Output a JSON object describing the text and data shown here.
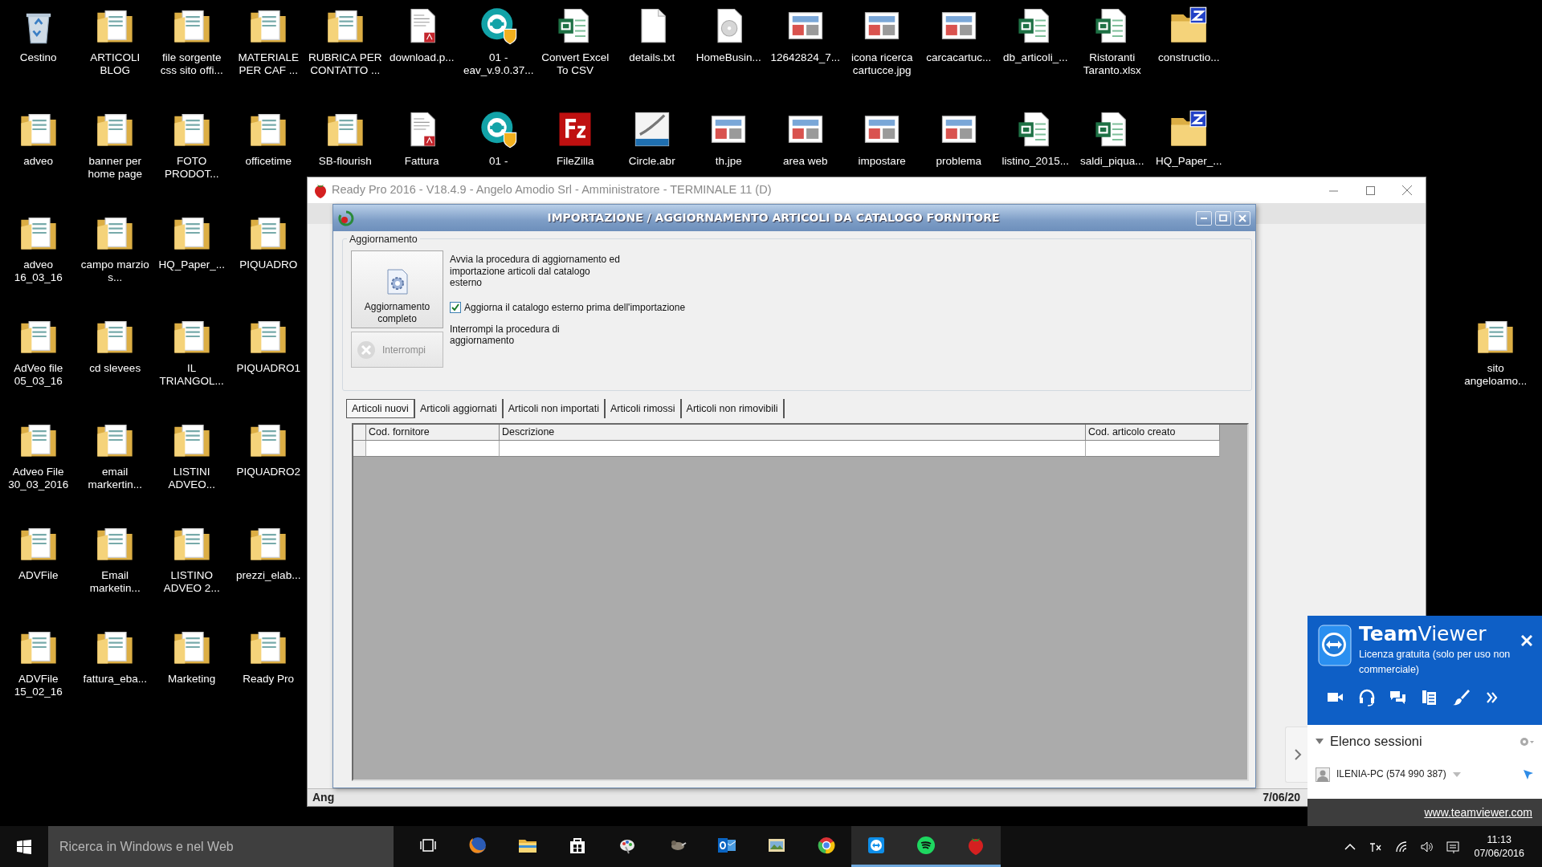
{
  "desktop": {
    "icon_columns": [
      [
        {
          "label": "Cestino",
          "kind": "recycle"
        },
        {
          "label": "adveo",
          "kind": "folder"
        },
        {
          "label": "adveo 16_03_16",
          "kind": "folder"
        },
        {
          "label": "AdVeo file 05_03_16",
          "kind": "folder"
        },
        {
          "label": "Adveo File 30_03_2016",
          "kind": "folder"
        },
        {
          "label": "ADVFile",
          "kind": "folder"
        },
        {
          "label": "ADVFile 15_02_16",
          "kind": "folder"
        }
      ],
      [
        {
          "label": "ARTICOLI BLOG",
          "kind": "folder"
        },
        {
          "label": "banner per home page",
          "kind": "folder"
        },
        {
          "label": "campo marzio s...",
          "kind": "folder"
        },
        {
          "label": "cd slevees",
          "kind": "folder"
        },
        {
          "label": "email markertin...",
          "kind": "folder"
        },
        {
          "label": "Email marketin...",
          "kind": "folder"
        },
        {
          "label": "fattura_eba...",
          "kind": "folder"
        }
      ],
      [
        {
          "label": "file sorgente css sito offi...",
          "kind": "folder"
        },
        {
          "label": "FOTO PRODOT...",
          "kind": "folder"
        },
        {
          "label": "HQ_Paper_...",
          "kind": "folder"
        },
        {
          "label": "IL TRIANGOL...",
          "kind": "folder"
        },
        {
          "label": "LISTINI ADVEO...",
          "kind": "folder"
        },
        {
          "label": "LISTINO ADVEO 2...",
          "kind": "folder"
        },
        {
          "label": "Marketing",
          "kind": "folder"
        }
      ],
      [
        {
          "label": "MATERIALE PER CAF ...",
          "kind": "folder"
        },
        {
          "label": "officetime",
          "kind": "folder"
        },
        {
          "label": "PIQUADRO",
          "kind": "folder"
        },
        {
          "label": "PIQUADRO1",
          "kind": "folder"
        },
        {
          "label": "PIQUADRO2",
          "kind": "folder"
        },
        {
          "label": "prezzi_elab...",
          "kind": "folder"
        },
        {
          "label": "Ready Pro",
          "kind": "folder"
        }
      ],
      [
        {
          "label": "RUBRICA PER CONTATTO ...",
          "kind": "folder"
        },
        {
          "label": "SB-flourish",
          "kind": "folder"
        }
      ],
      [
        {
          "label": "download.p...",
          "kind": "pdf"
        },
        {
          "label": "Fattura",
          "kind": "pdf"
        }
      ],
      [
        {
          "label": "01 - eav_v.9.0.37...",
          "kind": "app"
        },
        {
          "label": "01 -",
          "kind": "app"
        }
      ],
      [
        {
          "label": "Convert Excel To CSV",
          "kind": "spreadsheet"
        },
        {
          "label": "FileZilla",
          "kind": "ftp"
        }
      ],
      [
        {
          "label": "details.txt",
          "kind": "document"
        },
        {
          "label": "Circle.abr",
          "kind": "brushes"
        }
      ],
      [
        {
          "label": "HomeBusin...",
          "kind": "disc"
        },
        {
          "label": "th.jpe",
          "kind": "image"
        }
      ],
      [
        {
          "label": "12642824_7...",
          "kind": "image"
        },
        {
          "label": "area web",
          "kind": "image"
        }
      ],
      [
        {
          "label": "icona ricerca cartucce.jpg",
          "kind": "image"
        },
        {
          "label": "impostare",
          "kind": "image"
        }
      ],
      [
        {
          "label": "carcacartuc...",
          "kind": "image"
        },
        {
          "label": "problema",
          "kind": "image"
        }
      ],
      [
        {
          "label": "db_articoli_...",
          "kind": "spreadsheet"
        },
        {
          "label": "listino_2015...",
          "kind": "spreadsheet"
        }
      ],
      [
        {
          "label": "Ristoranti Taranto.xlsx",
          "kind": "spreadsheet"
        },
        {
          "label": "saldi_piqua...",
          "kind": "spreadsheet"
        }
      ],
      [
        {
          "label": "constructio...",
          "kind": "archive"
        },
        {
          "label": "HQ_Paper_...",
          "kind": "archive"
        }
      ]
    ],
    "side_icons": [
      {
        "label": "sito angeloamo...",
        "kind": "folder"
      }
    ]
  },
  "main_window": {
    "title": "Ready Pro 2016 - V18.4.9 - Angelo Amodio Srl - Amministratore - TERMINALE 11 (D)",
    "status_left": "Ang",
    "status_right": "7/06/20"
  },
  "dialog": {
    "title": "IMPORTAZIONE / AGGIORNAMENTO ARTICOLI DA CATALOGO FORNITORE",
    "group_title": "Aggiornamento",
    "full_update_button": "Aggiornamento completo",
    "full_update_text": "Avvia la procedura di aggiornamento ed importazione articoli dal catalogo esterno",
    "checkbox": {
      "label": "Aggiorna il catalogo esterno prima dell'importazione",
      "checked": true
    },
    "stop_button": {
      "label": "Interrompi",
      "disabled": true
    },
    "stop_text": "Interrompi la procedura di aggiornamento",
    "tabs": [
      {
        "label": "Articoli nuovi",
        "selected": true
      },
      {
        "label": "Articoli aggiornati",
        "selected": false
      },
      {
        "label": "Articoli non importati",
        "selected": false
      },
      {
        "label": "Articoli rimossi",
        "selected": false
      },
      {
        "label": "Articoli non rimovibili",
        "selected": false
      }
    ],
    "table": {
      "columns": [
        "Cod. fornitore",
        "Descrizione",
        "Cod. articolo creato"
      ]
    }
  },
  "teamviewer": {
    "brand": "**Team**Viewer",
    "license": "Licenza gratuita (solo per uso non commerciale)",
    "tools": [
      {
        "kind": "video"
      },
      {
        "kind": "headset"
      },
      {
        "kind": "chat"
      },
      {
        "kind": "file"
      },
      {
        "kind": "brush"
      },
      {
        "kind": "more"
      }
    ],
    "sessions": {
      "title": "Elenco sessioni",
      "expanded": true,
      "items": [
        {
          "label": "ILENIA-PC (574 990 387)"
        }
      ]
    },
    "link": "www.teamviewer.com"
  },
  "taskbar": {
    "search": {
      "placeholder": "Ricerca in Windows e nel Web"
    },
    "apps": [
      {
        "kind": "firefox",
        "active": false
      },
      {
        "kind": "explorer",
        "active": false
      },
      {
        "kind": "store",
        "active": false
      },
      {
        "kind": "paint",
        "active": false
      },
      {
        "kind": "gimp",
        "active": false
      },
      {
        "kind": "outlook",
        "active": false
      },
      {
        "kind": "photos",
        "active": false
      },
      {
        "kind": "chrome",
        "active": false
      },
      {
        "kind": "teamviewer",
        "active": true
      },
      {
        "kind": "spotify",
        "active": true
      },
      {
        "kind": "readypro",
        "active": true
      }
    ],
    "time": "11:13",
    "date": "07/06/2016"
  }
}
